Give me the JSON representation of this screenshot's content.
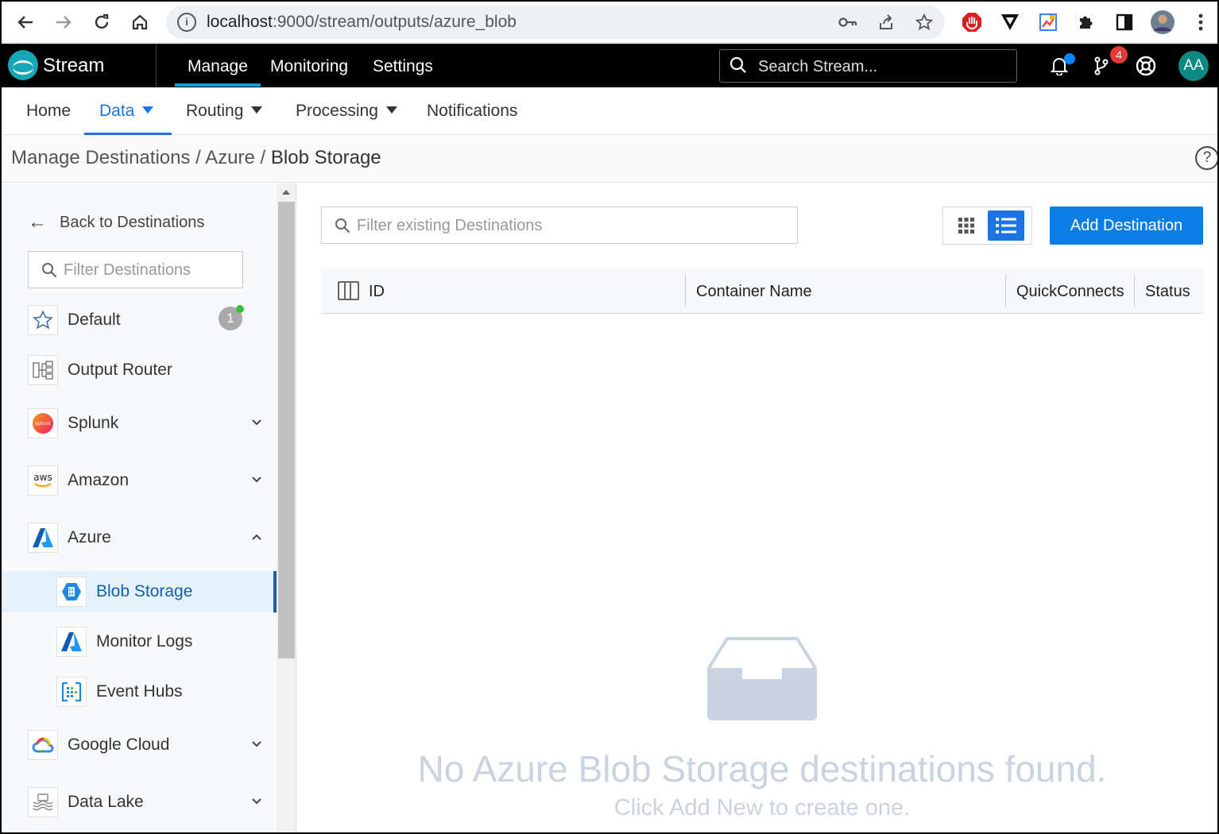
{
  "browser": {
    "url_host": "localhost",
    "url_rest": ":9000/stream/outputs/azure_blob",
    "extensions": [
      "adblock-icon",
      "vivaldi-icon",
      "colorpick-icon",
      "puzzle-icon",
      "sidepanel-icon",
      "profile-avatar",
      "kebab-menu-icon"
    ]
  },
  "app": {
    "brand": "Stream",
    "topnav": [
      "Manage",
      "Monitoring",
      "Settings"
    ],
    "active_topnav": "Manage",
    "search_placeholder": "Search Stream...",
    "git_badge": "4",
    "avatar": "AA"
  },
  "subnav": {
    "home": "Home",
    "data": "Data",
    "routing": "Routing",
    "processing": "Processing",
    "notifications": "Notifications",
    "active": "Data"
  },
  "breadcrumb": {
    "parts": [
      "Manage Destinations",
      "Azure",
      "Blob Storage"
    ],
    "sep": " / "
  },
  "sidebar": {
    "back": "Back to Destinations",
    "filter_placeholder": "Filter Destinations",
    "items": [
      {
        "label": "Default",
        "badge": "1"
      },
      {
        "label": "Output Router"
      },
      {
        "label": "Splunk"
      },
      {
        "label": "Amazon"
      },
      {
        "label": "Azure"
      },
      {
        "label": "Blob Storage"
      },
      {
        "label": "Monitor Logs"
      },
      {
        "label": "Event Hubs"
      },
      {
        "label": "Google Cloud"
      },
      {
        "label": "Data Lake"
      }
    ],
    "selected": "Blob Storage"
  },
  "main": {
    "filter_placeholder": "Filter existing Destinations",
    "add_button": "Add Destination",
    "view_mode": "list",
    "columns": [
      "ID",
      "Container Name",
      "QuickConnects",
      "Status"
    ],
    "rows": [],
    "empty_title": "No Azure Blob Storage destinations found.",
    "empty_sub": "Click Add New to create one."
  },
  "colors": {
    "accent": "#1a73e8",
    "add_button": "#0d7de6",
    "teal_brand": "#17a6b5",
    "empty_text": "#c9d4e0"
  }
}
